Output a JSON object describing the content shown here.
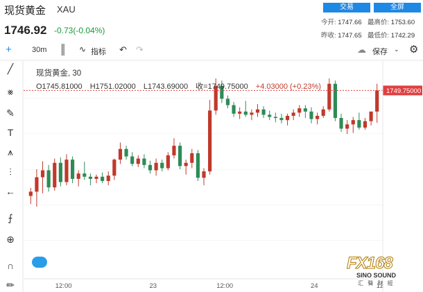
{
  "header": {
    "title": "现货黄金",
    "code": "XAU",
    "trade_button": "交易",
    "fullscreen_button": "全屏",
    "price": "1746.92",
    "change": "-0.73(-0.04%)",
    "open_label": "今开:",
    "open_value": "1747.66",
    "high_label": "最高价:",
    "high_value": "1753.60",
    "prevclose_label": "昨收:",
    "prevclose_value": "1747.65",
    "low_label": "最低价:",
    "low_value": "1742.29"
  },
  "toolbar": {
    "interval": "30m",
    "indicators": "指标",
    "save": "保存"
  },
  "legend": {
    "symbol_interval": "现货黄金, 30",
    "open": "O1745.81000",
    "high": "H1751.02000",
    "low": "L1743.69000",
    "close": "收=1749.75000",
    "change": "+4.03000 (+0.23%)"
  },
  "logo": {
    "main": "FX168",
    "sub": "SINO SOUND",
    "cn": "汇 聲 財 經"
  },
  "colors": {
    "up": "#c0392b",
    "down": "#2e8b57",
    "accent": "#1e88e5",
    "last_price_line": "#e04040"
  },
  "chart_data": {
    "type": "candlestick",
    "x_tick_labels": [
      "12:00",
      "23",
      "12:00",
      "24",
      "12"
    ],
    "last_price_label": "1749.75000",
    "ylim": [
      1715,
      1755
    ],
    "last_price": 1749.75,
    "candles": [
      [
        1730.0,
        1731.5,
        1728.5,
        1730.8
      ],
      [
        1730.8,
        1735.0,
        1728.0,
        1733.5
      ],
      [
        1733.5,
        1736.5,
        1730.5,
        1734.8
      ],
      [
        1734.8,
        1735.8,
        1730.8,
        1731.6
      ],
      [
        1731.6,
        1737.0,
        1731.0,
        1736.2
      ],
      [
        1736.2,
        1737.2,
        1731.8,
        1732.6
      ],
      [
        1732.6,
        1737.8,
        1732.0,
        1736.8
      ],
      [
        1736.8,
        1737.4,
        1732.4,
        1733.2
      ],
      [
        1733.2,
        1734.8,
        1731.8,
        1734.2
      ],
      [
        1734.2,
        1736.4,
        1733.0,
        1733.6
      ],
      [
        1733.6,
        1734.2,
        1732.0,
        1733.2
      ],
      [
        1733.2,
        1734.0,
        1732.4,
        1733.6
      ],
      [
        1733.6,
        1734.4,
        1732.4,
        1732.8
      ],
      [
        1732.8,
        1734.6,
        1732.0,
        1733.8
      ],
      [
        1733.8,
        1737.0,
        1733.0,
        1736.8
      ],
      [
        1736.8,
        1740.0,
        1736.0,
        1738.8
      ],
      [
        1738.8,
        1739.4,
        1736.8,
        1737.4
      ],
      [
        1737.4,
        1738.2,
        1735.6,
        1736.0
      ],
      [
        1736.0,
        1737.6,
        1735.4,
        1737.0
      ],
      [
        1737.0,
        1737.8,
        1735.2,
        1735.8
      ],
      [
        1735.8,
        1736.6,
        1734.2,
        1734.8
      ],
      [
        1734.8,
        1737.0,
        1733.8,
        1736.2
      ],
      [
        1736.2,
        1736.8,
        1734.6,
        1735.2
      ],
      [
        1735.2,
        1738.2,
        1734.8,
        1737.6
      ],
      [
        1737.6,
        1740.8,
        1737.0,
        1739.4
      ],
      [
        1739.4,
        1740.0,
        1735.0,
        1735.6
      ],
      [
        1735.6,
        1736.8,
        1734.0,
        1736.2
      ],
      [
        1736.2,
        1738.8,
        1735.2,
        1738.0
      ],
      [
        1738.0,
        1738.6,
        1732.8,
        1733.4
      ],
      [
        1733.4,
        1735.2,
        1732.0,
        1734.6
      ],
      [
        1734.6,
        1748.0,
        1734.0,
        1746.0
      ],
      [
        1746.0,
        1752.0,
        1745.2,
        1750.6
      ],
      [
        1750.6,
        1751.6,
        1747.4,
        1748.2
      ],
      [
        1748.2,
        1748.8,
        1746.4,
        1747.0
      ],
      [
        1747.0,
        1747.6,
        1744.8,
        1745.4
      ],
      [
        1745.4,
        1746.6,
        1744.4,
        1745.8
      ],
      [
        1745.8,
        1747.8,
        1744.8,
        1745.2
      ],
      [
        1745.2,
        1746.2,
        1744.2,
        1745.6
      ],
      [
        1745.6,
        1747.2,
        1744.8,
        1746.2
      ],
      [
        1746.2,
        1746.8,
        1744.6,
        1745.2
      ],
      [
        1745.2,
        1746.0,
        1744.2,
        1744.8
      ],
      [
        1744.8,
        1745.6,
        1743.8,
        1744.6
      ],
      [
        1744.6,
        1745.4,
        1743.6,
        1744.2
      ],
      [
        1744.2,
        1745.4,
        1743.2,
        1745.0
      ],
      [
        1745.0,
        1746.2,
        1744.2,
        1745.6
      ],
      [
        1745.6,
        1747.0,
        1744.8,
        1746.4
      ],
      [
        1746.4,
        1747.0,
        1744.6,
        1745.8
      ],
      [
        1745.8,
        1746.6,
        1743.6,
        1744.4
      ],
      [
        1744.4,
        1745.6,
        1743.4,
        1745.0
      ],
      [
        1745.0,
        1746.8,
        1744.6,
        1746.2
      ],
      [
        1746.2,
        1752.0,
        1745.8,
        1751.0
      ],
      [
        1751.0,
        1751.6,
        1744.0,
        1744.6
      ],
      [
        1744.6,
        1745.4,
        1742.0,
        1742.6
      ],
      [
        1742.6,
        1744.2,
        1741.6,
        1743.4
      ],
      [
        1743.4,
        1744.8,
        1741.8,
        1744.2
      ],
      [
        1744.2,
        1745.6,
        1742.4,
        1742.8
      ],
      [
        1742.8,
        1744.6,
        1742.4,
        1744.0
      ],
      [
        1744.0,
        1745.8,
        1743.2,
        1745.8
      ],
      [
        1745.8,
        1751.0,
        1743.7,
        1749.75
      ]
    ]
  }
}
